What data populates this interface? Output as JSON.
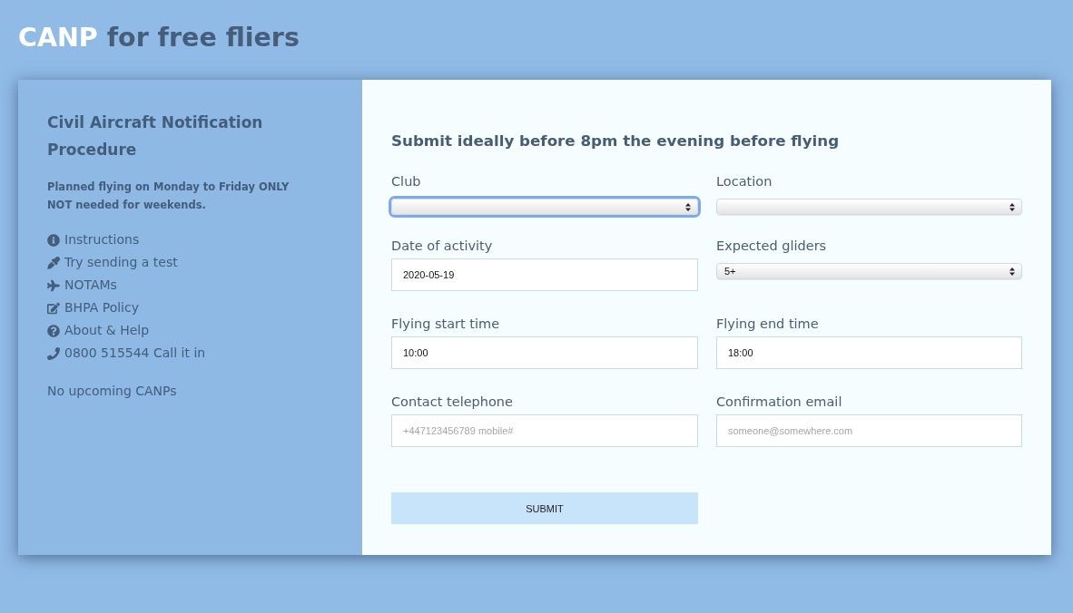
{
  "header": {
    "title": {
      "highlight": "CANP",
      "rest": "for free fliers"
    }
  },
  "sidebar": {
    "heading": "Civil Aircraft Notification Procedure",
    "notice": [
      "Planned flying on Monday to Friday ONLY",
      "NOT needed for weekends."
    ],
    "links": [
      {
        "label": "Instructions"
      },
      {
        "label": "Try sending a test"
      },
      {
        "label": "NOTAMs"
      },
      {
        "label": "BHPA Policy"
      },
      {
        "label": "About & Help"
      },
      {
        "label": "0800 515544 Call it in"
      }
    ],
    "status": "No upcoming CANPs"
  },
  "form": {
    "heading": "Submit ideally before 8pm the evening before flying",
    "fields": [
      {
        "kind": "select",
        "label": "Club",
        "focused": true
      },
      {
        "kind": "select",
        "label": "Location",
        "focused": false
      },
      {
        "kind": "text",
        "label": "Date of activity",
        "value": "2020-05-19",
        "focused": false
      },
      {
        "kind": "select",
        "label": "Expected gliders",
        "value": "5+",
        "focused": false
      },
      {
        "kind": "text",
        "label": "Flying start time",
        "value": "10:00",
        "focused": false
      },
      {
        "kind": "text",
        "label": "Flying end time",
        "value": "18:00",
        "focused": false
      },
      {
        "kind": "text",
        "label": "Contact telephone",
        "placeholder": "+447123456789 mobile#",
        "focused": false
      },
      {
        "kind": "text",
        "label": "Confirmation email",
        "placeholder": "someone@somewhere.com",
        "focused": false
      }
    ],
    "submit": "SUBMIT"
  }
}
